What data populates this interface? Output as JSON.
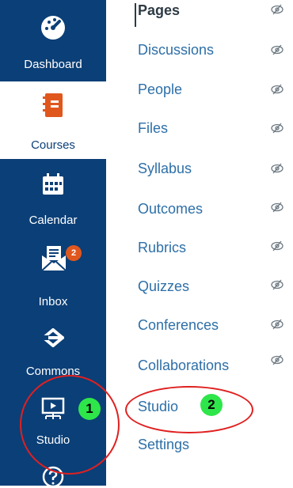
{
  "global_nav": {
    "dashboard": "Dashboard",
    "courses": "Courses",
    "calendar": "Calendar",
    "inbox": "Inbox",
    "inbox_badge": "2",
    "commons": "Commons",
    "studio": "Studio"
  },
  "course_nav": {
    "pages": "Pages",
    "items": [
      "Discussions",
      "People",
      "Files",
      "Syllabus",
      "Outcomes",
      "Rubrics",
      "Quizzes",
      "Conferences",
      "Collaborations",
      "Studio",
      "Settings"
    ]
  },
  "annotations": {
    "first": "1",
    "second": "2"
  },
  "colors": {
    "nav_bg": "#0b3f77",
    "link": "#2d6fa8",
    "highlight": "#e02020",
    "marker": "#2ee64a"
  }
}
